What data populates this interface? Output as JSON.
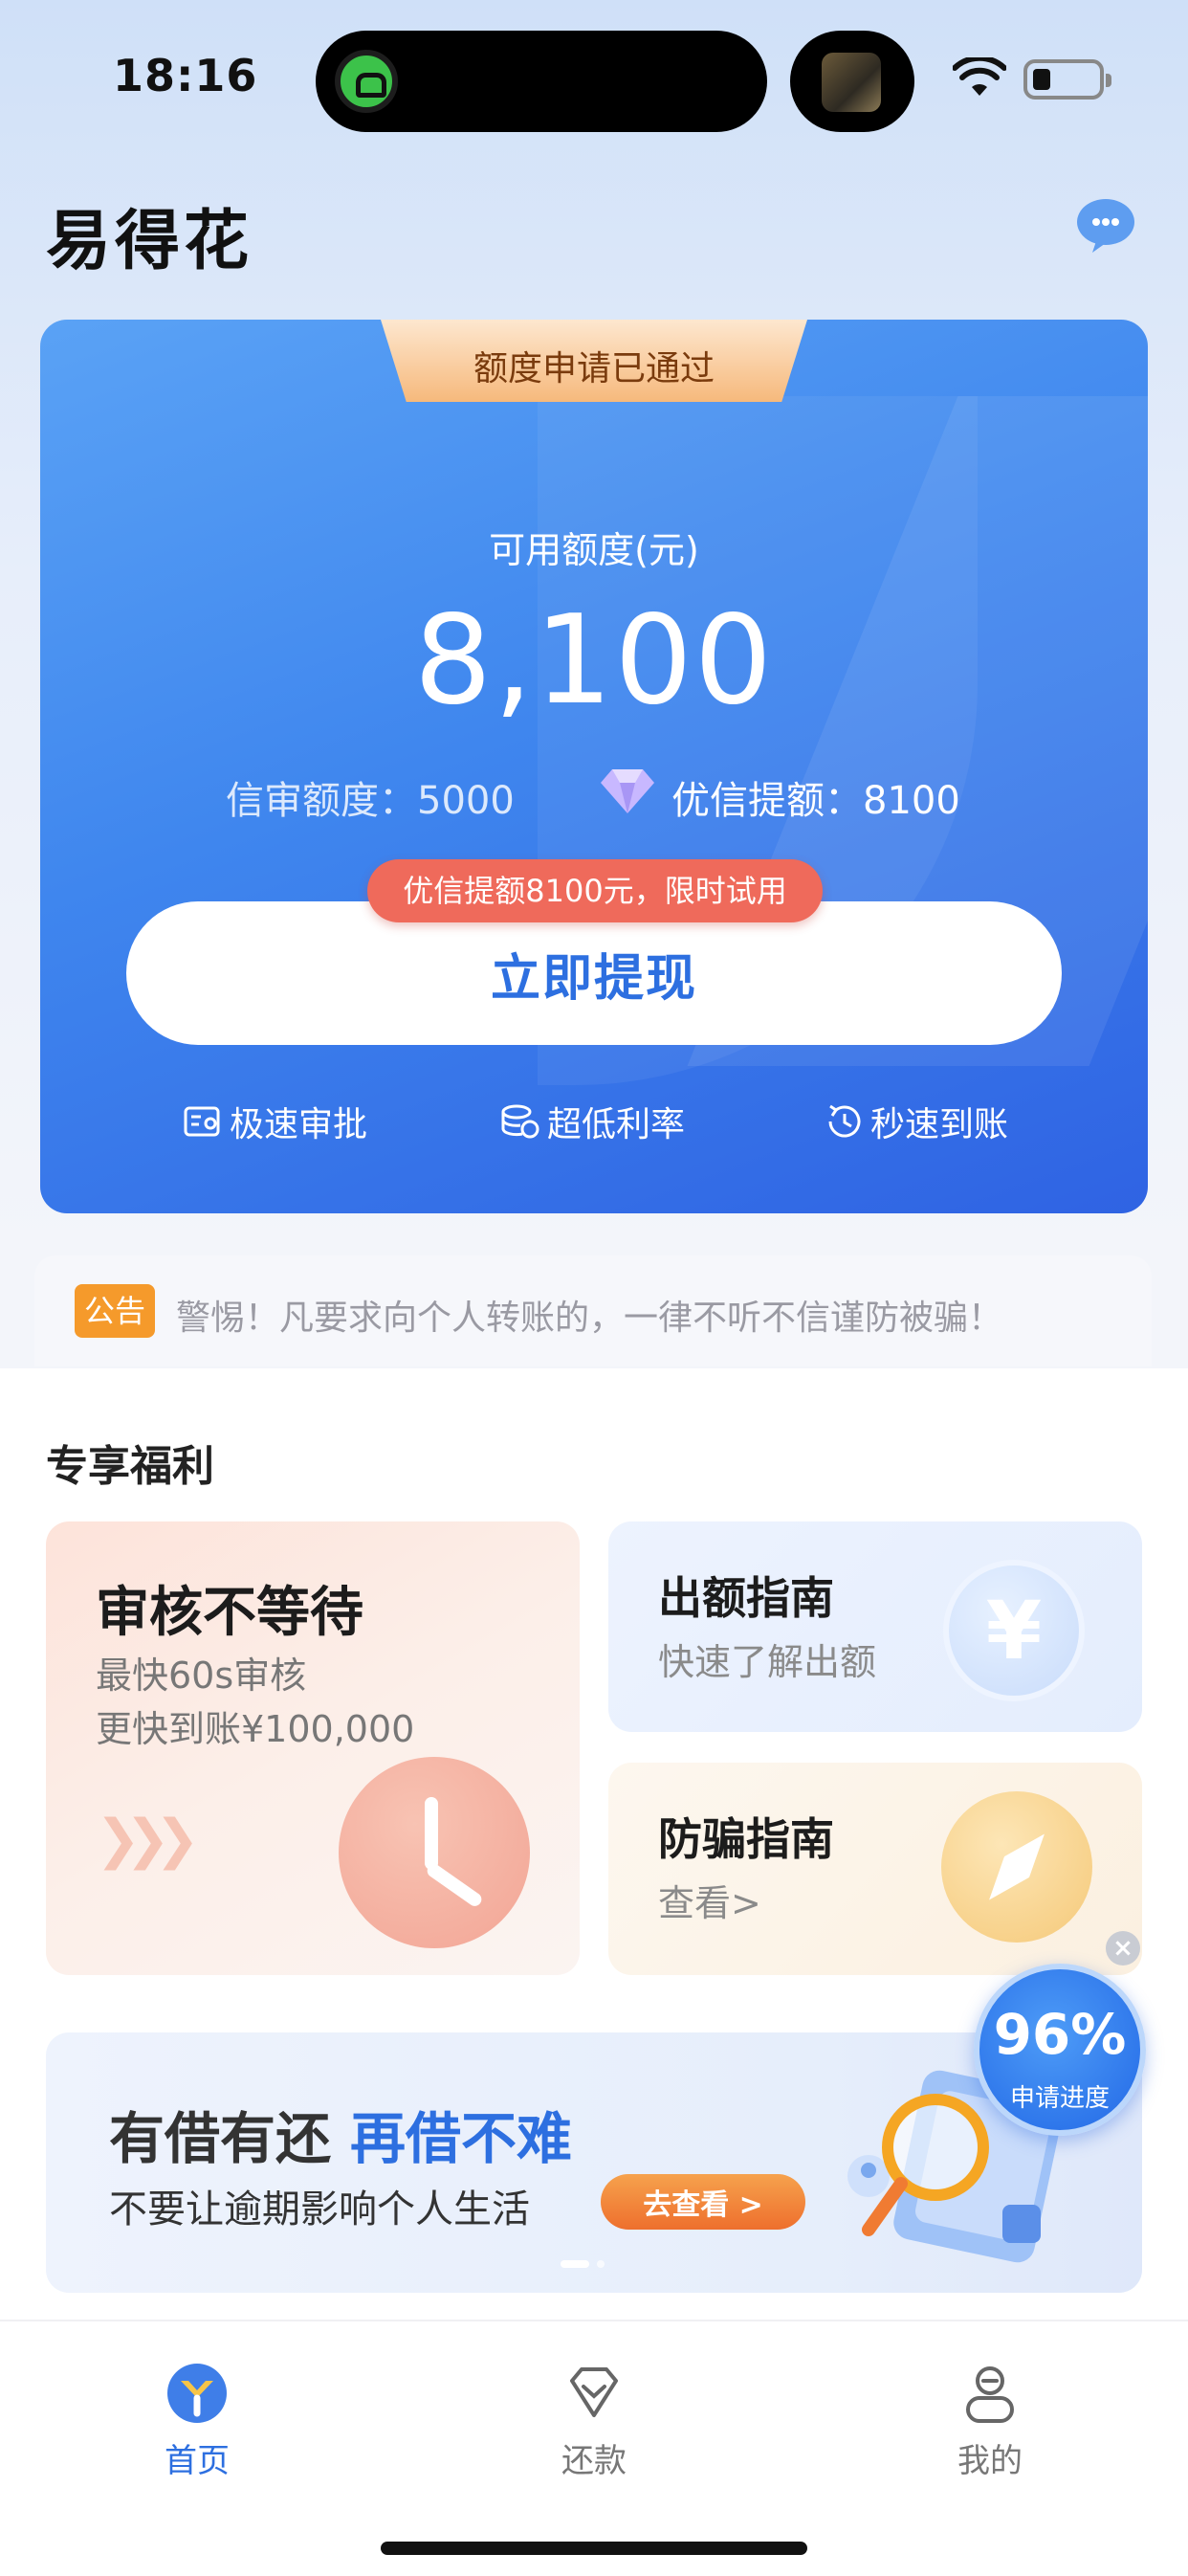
{
  "status_bar": {
    "time": "18:16"
  },
  "header": {
    "app_title": "易得花"
  },
  "credit_card": {
    "approved_badge": "额度申请已通过",
    "available_label": "可用额度(元)",
    "available_amount": "8,100",
    "credit_limit_text": "信审额度：5000",
    "vip_limit_text": "优信提额：8100",
    "promo_pill": "优信提额8100元，限时试用",
    "withdraw_button": "立即提现",
    "features": [
      "极速审批",
      "超低利率",
      "秒速到账"
    ]
  },
  "notice": {
    "tag": "公告",
    "text": "警惕！凡要求向个人转账的，一律不听不信谨防被骗！"
  },
  "benefits": {
    "section_title": "专享福利",
    "review": {
      "title": "审核不等待",
      "line1": "最快60s审核",
      "line2": "更快到账¥100,000"
    },
    "quota_guide": {
      "title": "出额指南",
      "subtitle": "快速了解出额"
    },
    "fraud_guide": {
      "title": "防骗指南",
      "subtitle": "查看>"
    }
  },
  "banner": {
    "title_part1": "有借有还",
    "title_part2": "再借不难",
    "subtitle": "不要让逾期影响个人生活",
    "button": "去查看 >"
  },
  "progress_float": {
    "value": "96%",
    "label": "申请进度"
  },
  "tabbar": {
    "items": [
      "首页",
      "还款",
      "我的"
    ],
    "active": "首页"
  },
  "colors": {
    "primary": "#2d6fe0",
    "card_start": "#5aa2f5",
    "card_end": "#2f63e3",
    "promo": "#ef6a5b",
    "notice_tag": "#f59a2b"
  }
}
